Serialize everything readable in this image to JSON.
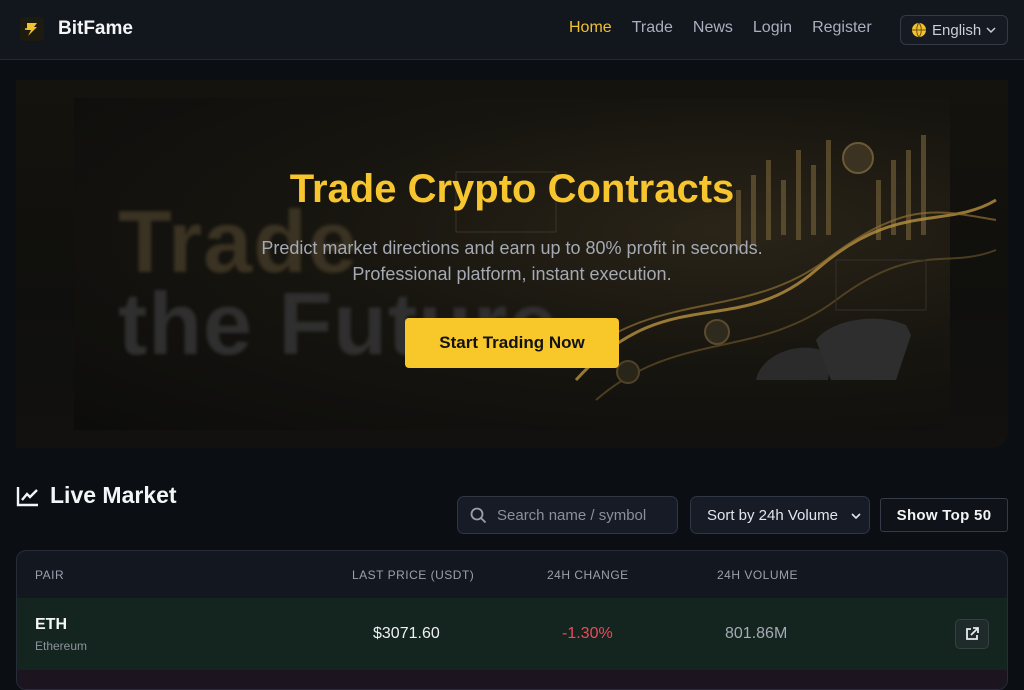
{
  "brand": {
    "name": "BitFame"
  },
  "nav": {
    "links": [
      {
        "label": "Home",
        "active": true
      },
      {
        "label": "Trade",
        "active": false
      },
      {
        "label": "News",
        "active": false
      },
      {
        "label": "Login",
        "active": false
      },
      {
        "label": "Register",
        "active": false
      }
    ],
    "language": "English"
  },
  "hero": {
    "title": "Trade Crypto Contracts",
    "subtitle_line1": "Predict market directions and earn up to 80% profit in seconds.",
    "subtitle_line2": "Professional platform, instant execution.",
    "cta_label": "Start Trading Now",
    "bg_text_line1": "Trade",
    "bg_text_line2": "the Future"
  },
  "market": {
    "title": "Live Market",
    "search_placeholder": "Search name / symbol",
    "sort_selected": "Sort by 24h Volume",
    "top_button": "Show Top 50",
    "columns": [
      "PAIR",
      "LAST PRICE (USDT)",
      "24H CHANGE",
      "24H VOLUME"
    ],
    "rows": [
      {
        "symbol": "ETH",
        "name": "Ethereum",
        "price": "$3071.60",
        "change": "-1.30%",
        "volume": "801.86M"
      }
    ]
  },
  "colors": {
    "accent": "#f7c62f",
    "negative": "#f0485a",
    "background": "#0b0e13"
  }
}
